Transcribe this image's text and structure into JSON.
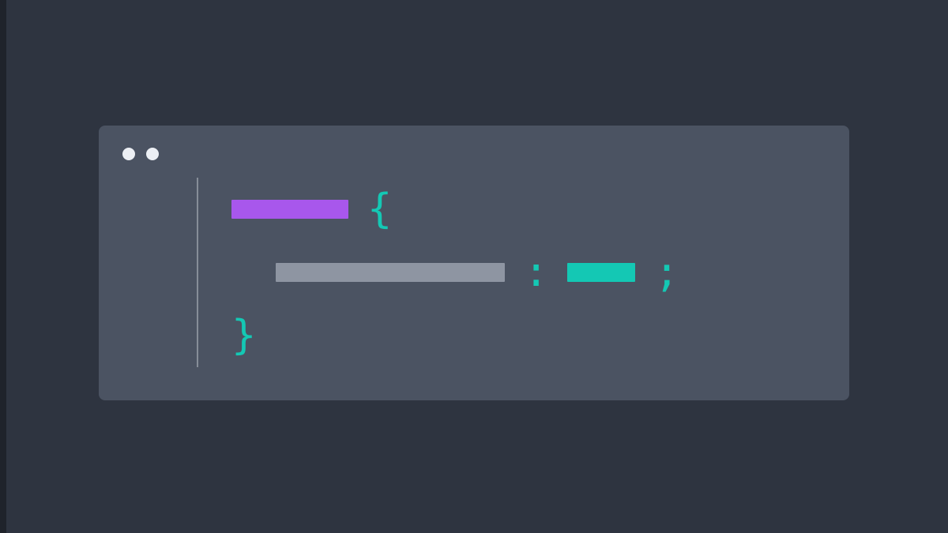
{
  "colors": {
    "background": "#2e3440",
    "window": "#4b5362",
    "titlebar_dot": "#eceff4",
    "gutter": "#9aa0ab",
    "selector_token": "#a857ec",
    "property_token": "#8e95a2",
    "value_token": "#14c8b4",
    "punctuation": "#14c8b4"
  },
  "punct": {
    "open_brace": "{",
    "close_brace": "}",
    "colon": ":",
    "semicolon": ";"
  },
  "description": "Stylized code editor window showing abstract CSS rule: selector { property: value; }"
}
